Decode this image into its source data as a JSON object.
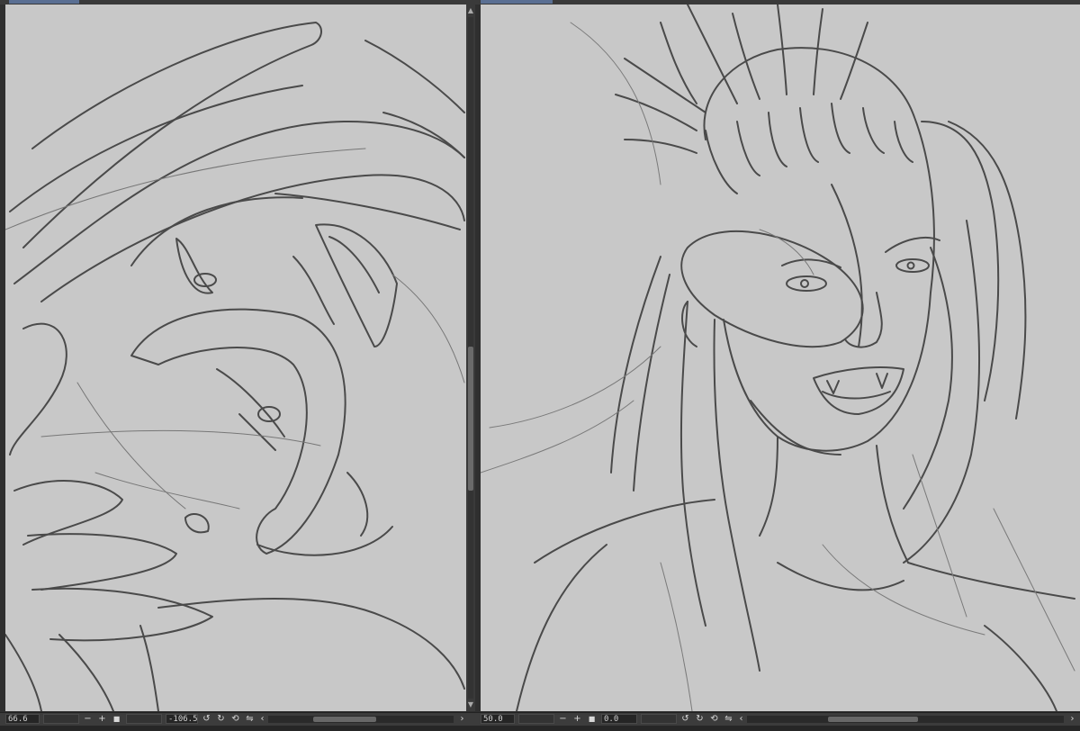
{
  "left_view": {
    "zoom_value": "66.6",
    "rotation_value": "-106.5",
    "zoom_out_symbol": "−",
    "zoom_in_symbol": "+",
    "fit_symbol": "■",
    "icons": [
      "rotate-left-icon",
      "rotate-right-icon",
      "reset-rotation-icon",
      "flip-horizontal-icon"
    ]
  },
  "right_view": {
    "zoom_value": "50.0",
    "rotation_value": "0.0",
    "zoom_out_symbol": "−",
    "zoom_in_symbol": "+",
    "fit_symbol": "■",
    "icons": [
      "rotate-left-icon",
      "rotate-right-icon",
      "reset-rotation-icon",
      "flip-horizontal-icon"
    ]
  },
  "colors": {
    "canvas_gray": "#c8c8c8",
    "pencil_stroke": "#4a4a4a",
    "ui_dark": "#2f2f2f",
    "tab_accent": "#5a6f93"
  },
  "glyphs": {
    "scroll_up": "▲",
    "scroll_down": "▼",
    "scroll_left": "‹",
    "scroll_right": "›",
    "rotate_left": "↺",
    "rotate_right": "↻",
    "reset": "⟲",
    "flip": "⇋"
  }
}
